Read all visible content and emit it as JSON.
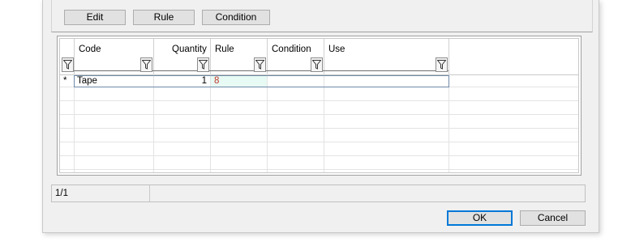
{
  "toolbar": {
    "edit_label": "Edit",
    "rule_label": "Rule",
    "condition_label": "Condition"
  },
  "grid": {
    "columns": [
      {
        "key": "code",
        "label": "Code"
      },
      {
        "key": "quantity",
        "label": "Quantity"
      },
      {
        "key": "rule",
        "label": "Rule"
      },
      {
        "key": "condition",
        "label": "Condition"
      },
      {
        "key": "use",
        "label": "Use"
      }
    ],
    "new_row_marker": "*",
    "rows": [
      {
        "code": "Tape",
        "quantity": "1",
        "rule": "8",
        "condition": "",
        "use": ""
      }
    ]
  },
  "status": {
    "record_counter": "1/1"
  },
  "footer": {
    "ok_label": "OK",
    "cancel_label": "Cancel"
  },
  "colors": {
    "rule_value": "#c0392b",
    "focus_border": "#0078d7",
    "selected_cell": "#e8faf4"
  }
}
